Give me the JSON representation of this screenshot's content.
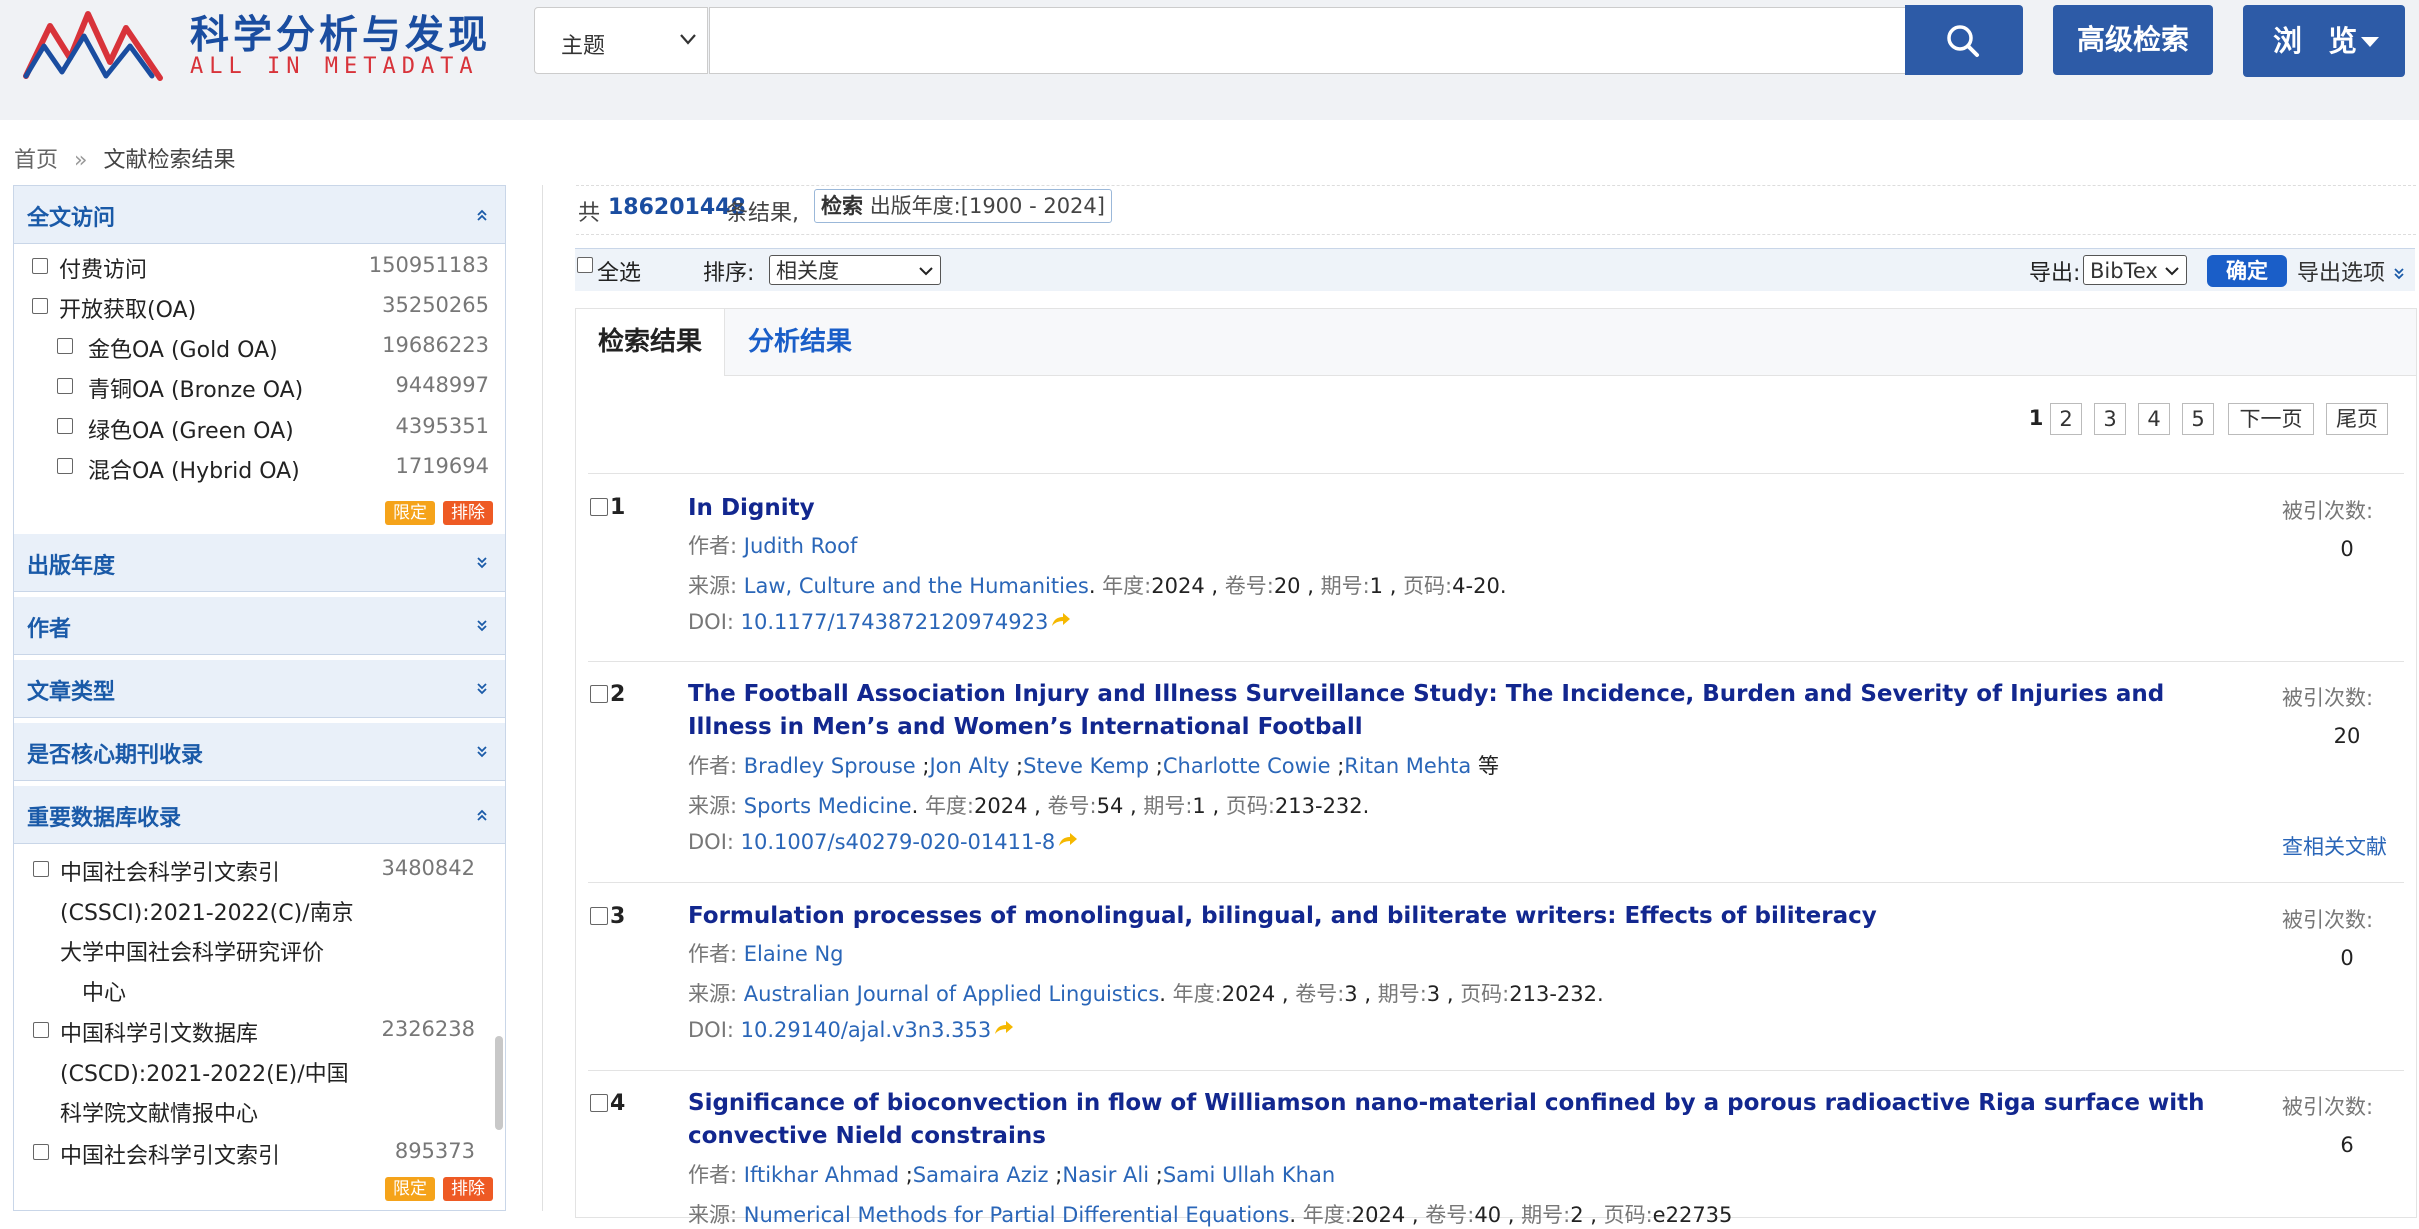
{
  "header": {
    "logo_title": "科学分析与发现",
    "logo_subtitle": "ALL IN METADATA",
    "search_type": "主题",
    "search_value": "",
    "advanced_search_label": "高级检索",
    "browse_label": "浏 览",
    "brand_color": "#2d5ba7"
  },
  "breadcrumb": {
    "home": "首页",
    "separator": "»",
    "current": "文献检索结果"
  },
  "sidebar": {
    "fulltext": {
      "title": "全文访问",
      "items": [
        {
          "label": "付费访问",
          "count": "150951183"
        },
        {
          "label": "开放获取(OA)",
          "count": "35250265"
        },
        {
          "label": "金色OA (Gold OA)",
          "count": "19686223"
        },
        {
          "label": "青铜OA (Bronze OA)",
          "count": "9448997"
        },
        {
          "label": "绿色OA (Green OA)",
          "count": "4395351"
        },
        {
          "label": "混合OA (Hybrid OA)",
          "count": "1719694"
        }
      ],
      "limit_label": "限定",
      "exclude_label": "排除"
    },
    "collapsed_facets": [
      "出版年度",
      "作者",
      "文章类型",
      "是否核心期刊收录"
    ],
    "databases": {
      "title": "重要数据库收录",
      "items": [
        {
          "lines": [
            "中国社会科学引文索引",
            "(CSSCI):2021-2022(C)/南京",
            "大学中国社会科学研究评价",
            "中心"
          ],
          "count": "3480842"
        },
        {
          "lines": [
            "中国科学引文数据库",
            "(CSCD):2021-2022(E)/中国",
            "科学院文献情报中心"
          ],
          "count": "2326238"
        },
        {
          "lines": [
            "中国社会科学引文索引"
          ],
          "count": "895373"
        }
      ],
      "limit_label": "限定",
      "exclude_label": "排除"
    }
  },
  "summary": {
    "prefix": "共",
    "total": "186201448",
    "suffix": "条结果,",
    "query_keyword": "检索",
    "query_text": "出版年度:[1900 - 2024]"
  },
  "toolbar": {
    "select_all": "全选",
    "sort_label": "排序:",
    "sort_value": "相关度",
    "export_label": "导出:",
    "export_value": "BibTex",
    "confirm": "确定",
    "export_options": "导出选项"
  },
  "tabs": {
    "results": "检索结果",
    "analysis": "分析结果"
  },
  "pager": {
    "pages": [
      "1",
      "2",
      "3",
      "4",
      "5"
    ],
    "next": "下一页",
    "last": "尾页"
  },
  "labels": {
    "author": "作者:",
    "source": "来源:",
    "year": "年度:",
    "volume": "卷号:",
    "issue": "期号:",
    "pages": "页码:",
    "doi": "DOI:",
    "cited": "被引次数:",
    "related": "查相关文献",
    "etal": "等"
  },
  "results": [
    {
      "num": "1",
      "title": "In Dignity",
      "authors": [
        "Judith Roof"
      ],
      "source": "Law, Culture and the Humanities",
      "year": "2024",
      "volume": "20",
      "issue": "1",
      "pages": "4-20",
      "doi": "10.1177/1743872120974923",
      "cited": "0"
    },
    {
      "num": "2",
      "title": "The Football Association Injury and Illness Surveillance Study: The Incidence, Burden and Severity of Injuries and Illness in Men’s and Women’s International Football",
      "authors": [
        "Bradley Sprouse",
        "Jon Alty",
        "Steve Kemp",
        "Charlotte Cowie",
        "Ritan Mehta"
      ],
      "source": "Sports Medicine",
      "year": "2024",
      "volume": "54",
      "issue": "1",
      "pages": "213-232",
      "doi": "10.1007/s40279-020-01411-8",
      "cited": "20"
    },
    {
      "num": "3",
      "title": "Formulation processes of monolingual, bilingual, and biliterate writers: Effects of biliteracy",
      "authors": [
        "Elaine Ng"
      ],
      "source": "Australian Journal of Applied Linguistics",
      "year": "2024",
      "volume": "3",
      "issue": "3",
      "pages": "213-232",
      "doi": "10.29140/ajal.v3n3.353",
      "cited": "0"
    },
    {
      "num": "4",
      "title": "Significance of bioconvection in flow of Williamson nano-material confined by a porous radioactive Riga surface with convective Nield constrains",
      "authors": [
        "Iftikhar Ahmad",
        "Samaira Aziz",
        "Nasir Ali",
        "Sami Ullah Khan"
      ],
      "source": "Numerical Methods for Partial Differential Equations",
      "year": "2024",
      "volume": "40",
      "issue": "2",
      "pages": "e22735",
      "cited": "6"
    }
  ]
}
